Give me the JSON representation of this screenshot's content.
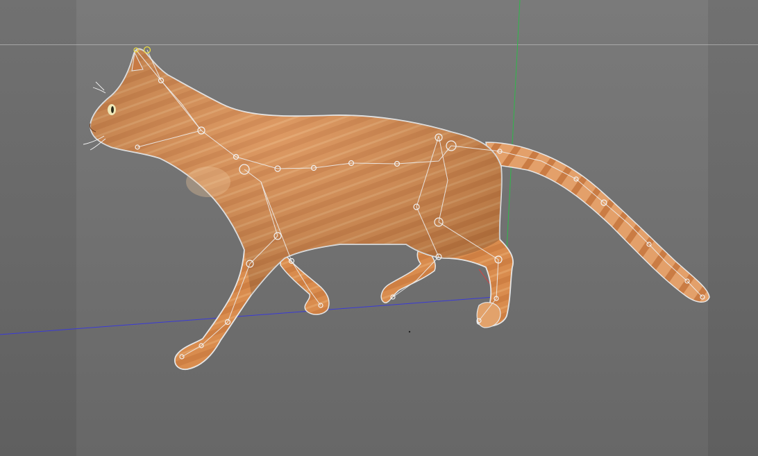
{
  "viewport": {
    "background_color": "#727272",
    "safe_frame_color": "#d2d2d2"
  },
  "axes": {
    "x_axis_color": "#3a3ad8",
    "y_axis_color": "#2fb84a",
    "z_axis_color": "#d84040"
  },
  "model": {
    "subject": "orange-tabby-cat",
    "fur_base_color": "#d98c4e",
    "fur_stripe_color": "#b9652f",
    "fur_light_color": "#efc79c",
    "outline_color": "#e6e6e6"
  },
  "rig": {
    "bone_color": "#eeeeee",
    "joint_color": "#f2f2f2",
    "selected_joint_color": "#f0e040"
  }
}
